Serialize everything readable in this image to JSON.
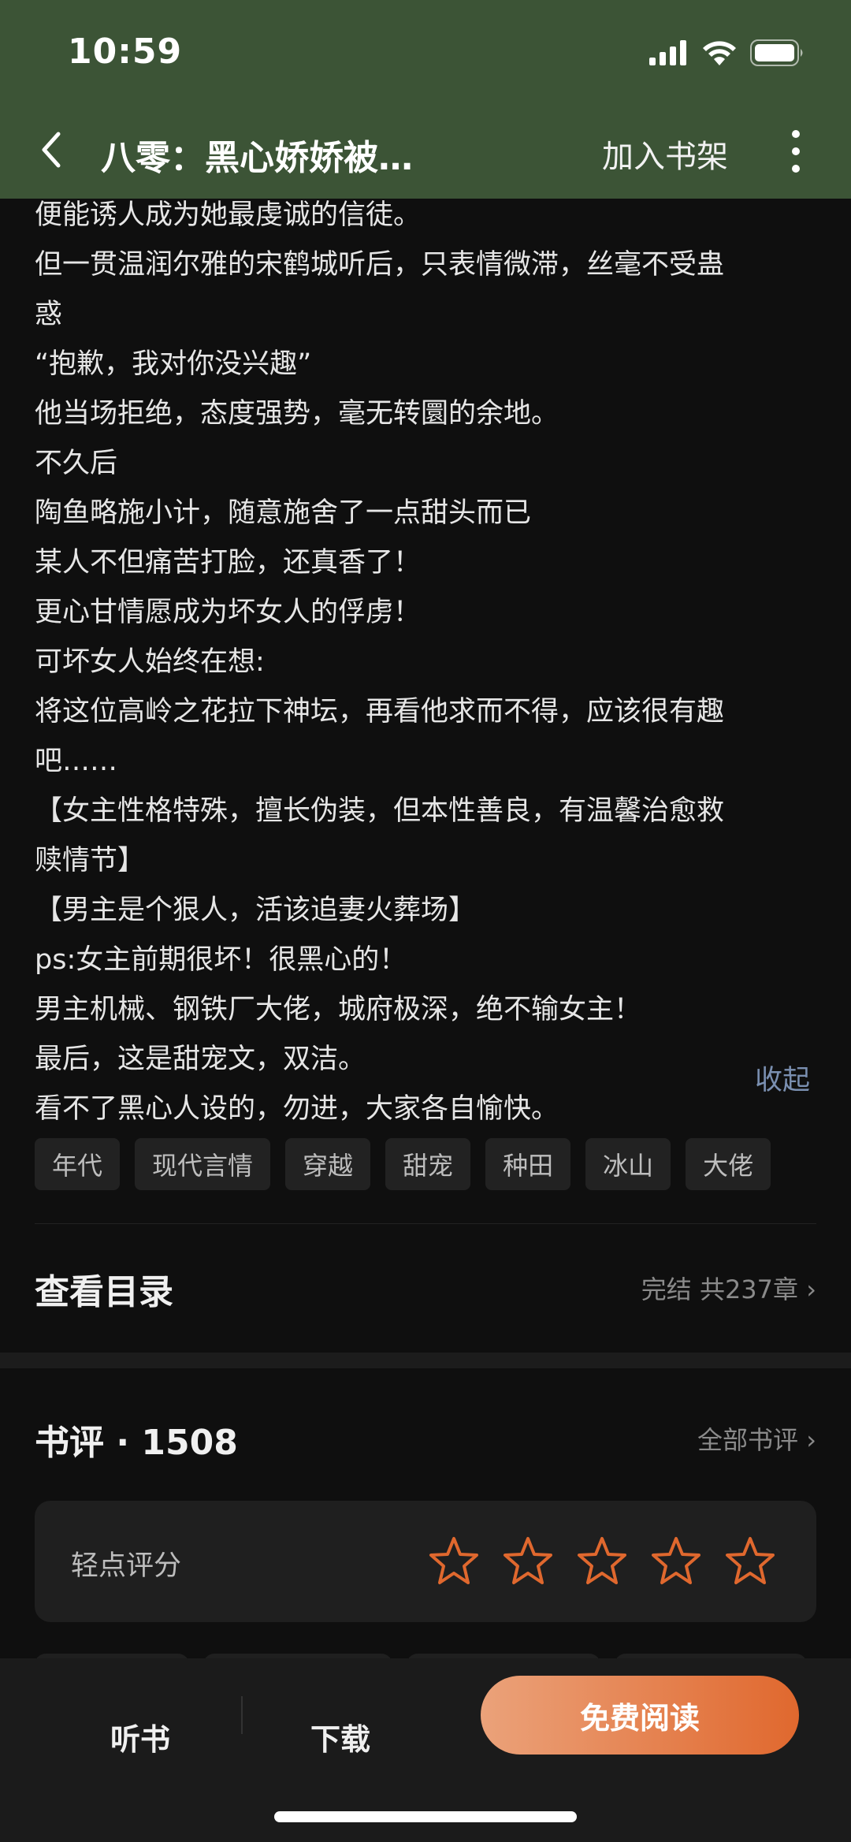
{
  "status_bar": {
    "time": "10:59"
  },
  "nav": {
    "title": "八零：黑心娇娇被…",
    "shelf_label": "加入书架"
  },
  "description": {
    "lines": [
      "便能诱人成为她最虔诚的信徒。",
      "但一贯温润尔雅的宋鹤城听后，只表情微滞，丝毫不受蛊",
      "惑",
      "“抱歉，我对你没兴趣”",
      "他当场拒绝，态度强势，毫无转圜的余地。",
      "不久后",
      "陶鱼略施小计，随意施舍了一点甜头而已",
      "某人不但痛苦打脸，还真香了！",
      "更心甘情愿成为坏女人的俘虏！",
      "可坏女人始终在想:",
      "将这位高岭之花拉下神坛，再看他求而不得，应该很有趣",
      "吧……",
      "【女主性格特殊，擅长伪装，但本性善良，有温馨治愈救",
      "赎情节】",
      "【男主是个狠人，活该追妻火葬场】",
      "ps:女主前期很坏！很黑心的！",
      "男主机械、钢铁厂大佬，城府极深，绝不输女主！",
      "最后，这是甜宠文，双洁。",
      "看不了黑心人设的，勿进，大家各自愉快。"
    ],
    "collapse_label": "收起"
  },
  "tags": [
    "年代",
    "现代言情",
    "穿越",
    "甜宠",
    "种田",
    "冰山",
    "大佬"
  ],
  "toc": {
    "title": "查看目录",
    "meta": "完结 共237章 ›"
  },
  "reviews": {
    "title": "书评 · 1508",
    "all_label": "全部书评 ›",
    "rating_label": "轻点评分",
    "star_color": "#e0682e"
  },
  "bottom_bar": {
    "listen": "听书",
    "download": "下载",
    "read": "免费阅读"
  }
}
